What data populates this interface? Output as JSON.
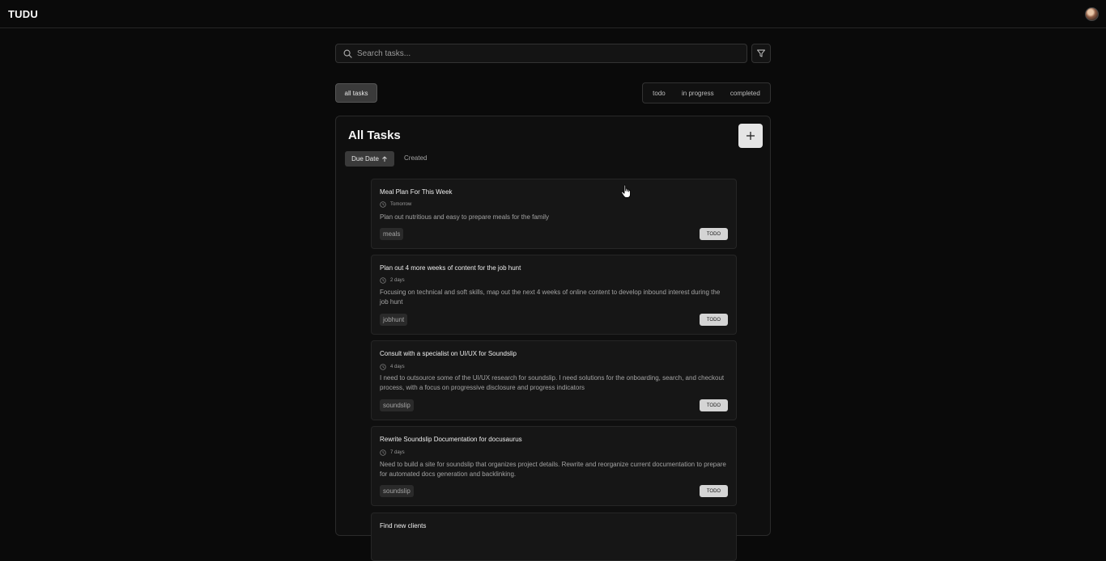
{
  "app": {
    "name": "TUDU"
  },
  "search": {
    "placeholder": "Search tasks..."
  },
  "view_filter": {
    "all_label": "all tasks"
  },
  "status_tabs": [
    "todo",
    "in progress",
    "completed"
  ],
  "panel": {
    "title": "All Tasks",
    "add_label": "+",
    "sort": {
      "due_label": "Due Date",
      "created_label": "Created"
    }
  },
  "tasks": [
    {
      "title": "Meal Plan For This Week",
      "due": "Tomorrow",
      "description": "Plan out nutritious and easy to prepare meals for the family",
      "tag": "meals",
      "status": "TODO"
    },
    {
      "title": "Plan out 4 more weeks of content for the job hunt",
      "due": "2 days",
      "description": "Focusing on technical and soft skills, map out the next 4 weeks of online content to develop inbound interest during the job hunt",
      "tag": "jobhunt",
      "status": "TODO"
    },
    {
      "title": "Consult with a specialist on UI/UX for Soundslip",
      "due": "4 days",
      "description": "I need to outsource some of the UI/UX research for soundslip. I need solutions for the onboarding, search, and checkout process, with a focus on progressive disclosure and progress indicators",
      "tag": "soundslip",
      "status": "TODO"
    },
    {
      "title": "Rewrite Soundslip Documentation for docusaurus",
      "due": "7 days",
      "description": "Need to build a site for soundslip that organizes project details. Rewrite and reorganize current documentation to prepare for automated docs generation and backlinking.",
      "tag": "soundslip",
      "status": "TODO"
    },
    {
      "title": "Find new clients"
    }
  ]
}
